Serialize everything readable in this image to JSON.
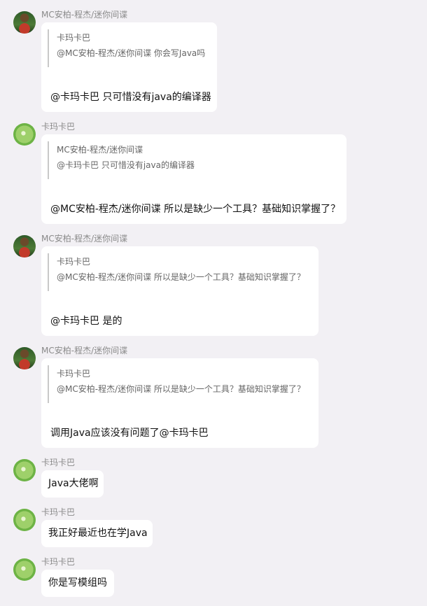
{
  "messages": [
    {
      "sender": "MC安柏-程杰/迷你间谍",
      "avatar": "mc-avatar",
      "quote": {
        "author": "卡玛卡巴",
        "text": "@MC安柏-程杰/迷你间谍 你会写Java吗"
      },
      "text": "@卡玛卡巴 只可惜没有java的编译器"
    },
    {
      "sender": "卡玛卡巴",
      "avatar": "kmk-avatar",
      "quote": {
        "author": "MC安柏-程杰/迷你间谍",
        "text": "@卡玛卡巴 只可惜没有java的编译器"
      },
      "text": "@MC安柏-程杰/迷你间谍 所以是缺少一个工具？基础知识掌握了？"
    },
    {
      "sender": "MC安柏-程杰/迷你间谍",
      "avatar": "mc-avatar",
      "quote": {
        "author": "卡玛卡巴",
        "text": "@MC安柏-程杰/迷你间谍 所以是缺少一个工具？基础知识掌握了？"
      },
      "text": "@卡玛卡巴 是的"
    },
    {
      "sender": "MC安柏-程杰/迷你间谍",
      "avatar": "mc-avatar",
      "quote": {
        "author": "卡玛卡巴",
        "text": "@MC安柏-程杰/迷你间谍 所以是缺少一个工具？基础知识掌握了？"
      },
      "text": "调用Java应该没有问题了@卡玛卡巴"
    },
    {
      "sender": "卡玛卡巴",
      "avatar": "kmk-avatar",
      "text": "Java大佬啊"
    },
    {
      "sender": "卡玛卡巴",
      "avatar": "kmk-avatar",
      "text": "我正好最近也在学Java"
    },
    {
      "sender": "卡玛卡巴",
      "avatar": "kmk-avatar",
      "text": "你是写模组吗"
    }
  ]
}
